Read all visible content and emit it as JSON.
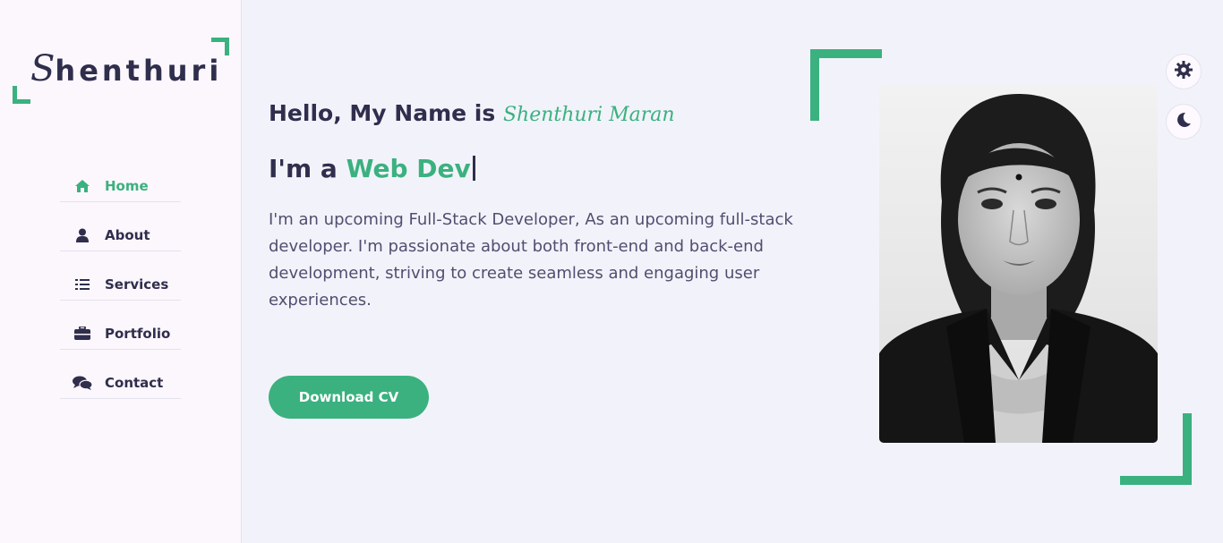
{
  "logo": {
    "first_letter": "S",
    "rest": "henthuri"
  },
  "nav": {
    "items": [
      {
        "label": "Home",
        "icon": "home-icon",
        "active": true
      },
      {
        "label": "About",
        "icon": "user-icon",
        "active": false
      },
      {
        "label": "Services",
        "icon": "list-icon",
        "active": false
      },
      {
        "label": "Portfolio",
        "icon": "briefcase-icon",
        "active": false
      },
      {
        "label": "Contact",
        "icon": "comments-icon",
        "active": false
      }
    ]
  },
  "hero": {
    "greeting": "Hello, My Name is",
    "name": "Shenthuri Maran",
    "role_prefix": "I'm a",
    "role_typed": "Web Dev",
    "description": "I'm an upcoming Full-Stack Developer, As an upcoming full-stack developer. I'm passionate about both front-end and back-end development, striving to create seamless and engaging user experiences.",
    "cv_button": "Download CV"
  },
  "controls": {
    "settings_icon": "gear-icon",
    "theme_icon": "moon-icon"
  },
  "colors": {
    "accent": "#3bb17f",
    "text": "#302e4d",
    "background": "#f2f3fa",
    "sidebar": "#fcf7fc"
  }
}
